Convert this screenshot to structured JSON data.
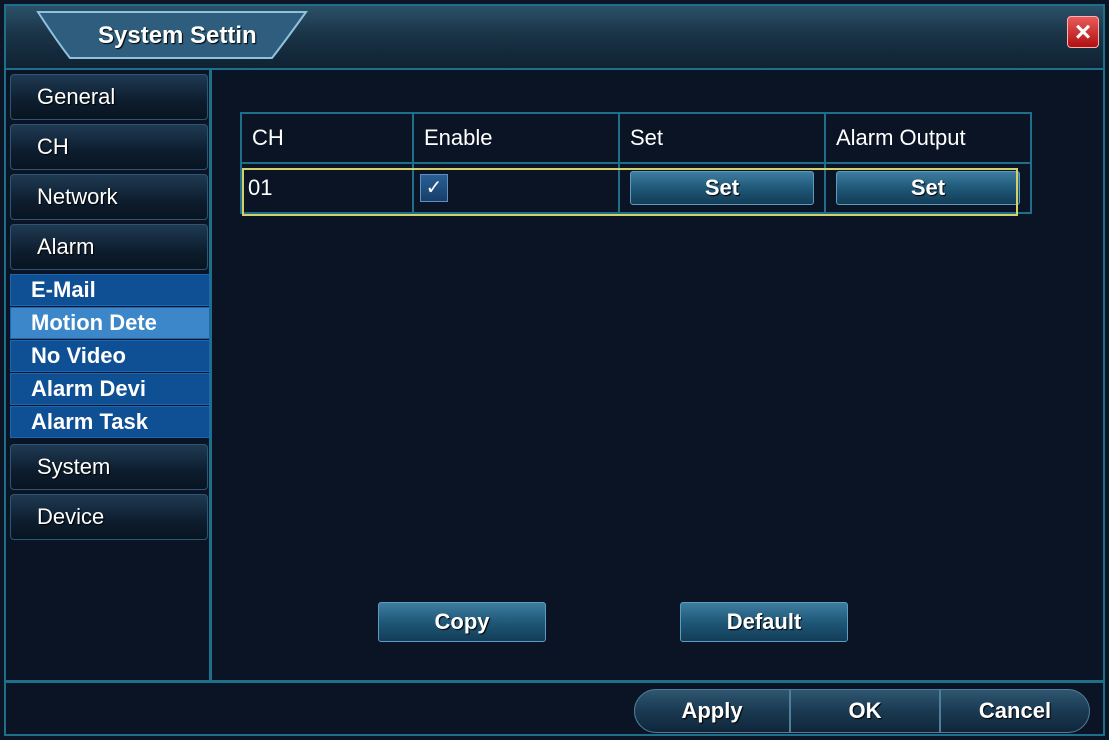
{
  "window": {
    "title": "System Settin",
    "close_icon": "close-icon"
  },
  "colors": {
    "accent_border": "#1d6f8a",
    "selection_outline": "#d7d06a",
    "active_subitem": "#3c87c9",
    "subitem": "#0f4f94",
    "close_red": "#c01818"
  },
  "sidebar": {
    "items": [
      {
        "label": "General"
      },
      {
        "label": "CH"
      },
      {
        "label": "Network"
      },
      {
        "label": "Alarm"
      },
      {
        "label": "System"
      },
      {
        "label": "Device"
      }
    ],
    "alarm_subitems": [
      {
        "label": "E-Mail",
        "active": false
      },
      {
        "label": "Motion Dete",
        "active": true
      },
      {
        "label": "No Video",
        "active": false
      },
      {
        "label": "Alarm Devi",
        "active": false
      },
      {
        "label": "Alarm Task",
        "active": false
      }
    ]
  },
  "table": {
    "headers": [
      "CH",
      "Enable",
      "Set",
      "Alarm Output"
    ],
    "rows": [
      {
        "ch": "01",
        "enable_mark": "✓",
        "enabled": true,
        "set_label": "Set",
        "alarm_output_label": "Set"
      }
    ]
  },
  "actions": {
    "copy_label": "Copy",
    "default_label": "Default"
  },
  "footer": {
    "apply_label": "Apply",
    "ok_label": "OK",
    "cancel_label": "Cancel"
  }
}
